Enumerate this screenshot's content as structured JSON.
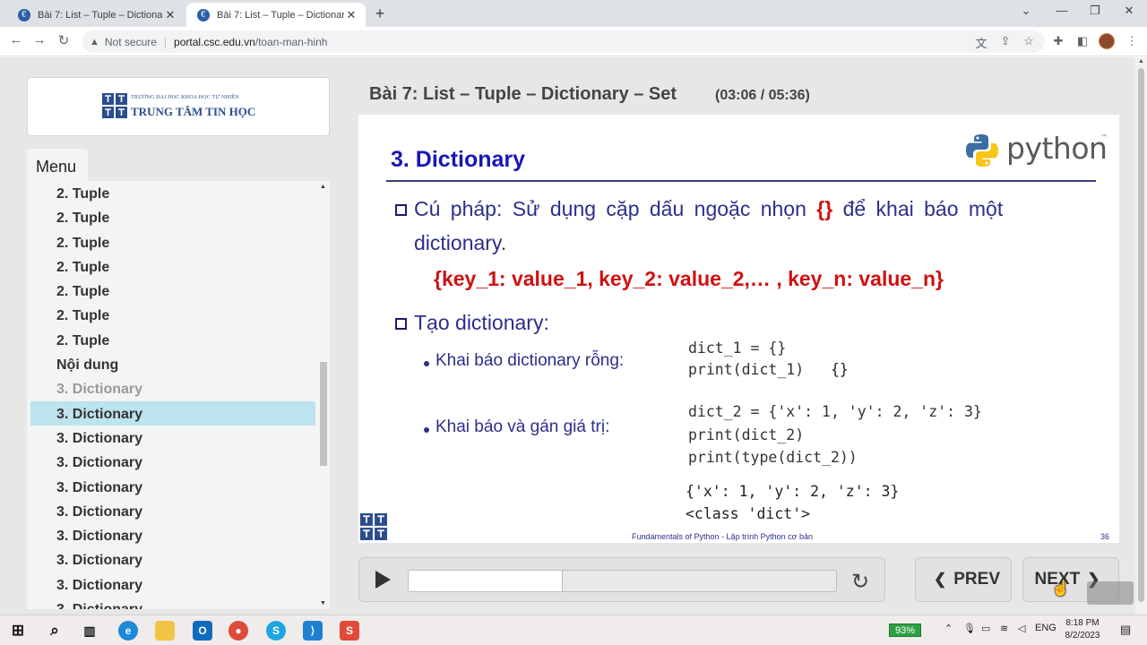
{
  "browser": {
    "tabs": [
      {
        "title": "Bài 7: List – Tuple – Dictionary – S"
      },
      {
        "title": "Bài 7: List – Tuple – Dictionary – S"
      }
    ],
    "new_tab_glyph": "+",
    "security_label": "Not secure",
    "url_host": "portal.csc.edu.vn",
    "url_path": "/toan-man-hinh"
  },
  "logo": {
    "small_text": "TRƯỜNG ĐẠI HỌC KHOA HỌC TỰ NHIÊN",
    "big_text": "TRUNG TÂM TIN HỌC"
  },
  "menu": {
    "title": "Menu",
    "items": [
      {
        "label": "2. Tuple",
        "state": "normal"
      },
      {
        "label": "2. Tuple",
        "state": "normal"
      },
      {
        "label": "2. Tuple",
        "state": "normal"
      },
      {
        "label": "2. Tuple",
        "state": "normal"
      },
      {
        "label": "2. Tuple",
        "state": "normal"
      },
      {
        "label": "2. Tuple",
        "state": "normal"
      },
      {
        "label": "2. Tuple",
        "state": "normal"
      },
      {
        "label": "Nội dung",
        "state": "normal"
      },
      {
        "label": "3. Dictionary",
        "state": "grey"
      },
      {
        "label": "3. Dictionary",
        "state": "active"
      },
      {
        "label": "3. Dictionary",
        "state": "normal"
      },
      {
        "label": "3. Dictionary",
        "state": "normal"
      },
      {
        "label": "3. Dictionary",
        "state": "normal"
      },
      {
        "label": "3. Dictionary",
        "state": "normal"
      },
      {
        "label": "3. Dictionary",
        "state": "normal"
      },
      {
        "label": "3. Dictionary",
        "state": "normal"
      },
      {
        "label": "3. Dictionary",
        "state": "normal"
      },
      {
        "label": "3. Dictionary",
        "state": "normal"
      }
    ]
  },
  "lesson": {
    "title": "Bài 7: List – Tuple – Dictionary – Set",
    "time": "(03:06 / 05:36)"
  },
  "slide": {
    "heading": "3. Dictionary",
    "python_word": "python",
    "python_tm": "™",
    "syntax_line1_a": "Cú pháp: Sử dụng cặp dấu ngoặc nhọn",
    "syntax_brace": "{}",
    "syntax_line1_b": "để khai báo một",
    "syntax_line2": "dictionary.",
    "syntax_example": "{key_1: value_1, key_2: value_2,… , key_n: value_n}",
    "create_heading": "Tạo dictionary:",
    "sub1": "Khai báo dictionary rỗng:",
    "sub2": "Khai báo và gán giá trị:",
    "code1_line1": "dict_1 = {}",
    "code1_line2": "print(dict_1)",
    "code1_output": "{}",
    "code2_line1": "dict_2 = {'x': 1, 'y': 2, 'z': 3}",
    "code2_line2": "print(dict_2)",
    "code2_line3": "print(type(dict_2))",
    "output_line1": "{'x': 1, 'y': 2, 'z': 3}",
    "output_line2": "<class 'dict'>",
    "footer": "Fundamentals of Python - Lập trình Python cơ bản",
    "page_number": "36"
  },
  "player": {
    "progress_fraction": 0.36,
    "prev_label": "PREV",
    "next_label": "NEXT"
  },
  "taskbar": {
    "battery": "93%",
    "language": "ENG",
    "time": "8:18 PM",
    "date": "8/2/2023"
  },
  "colors": {
    "active_menu": "#bde3ef",
    "slide_heading": "#1616b8",
    "syntax_red": "#d01010"
  }
}
